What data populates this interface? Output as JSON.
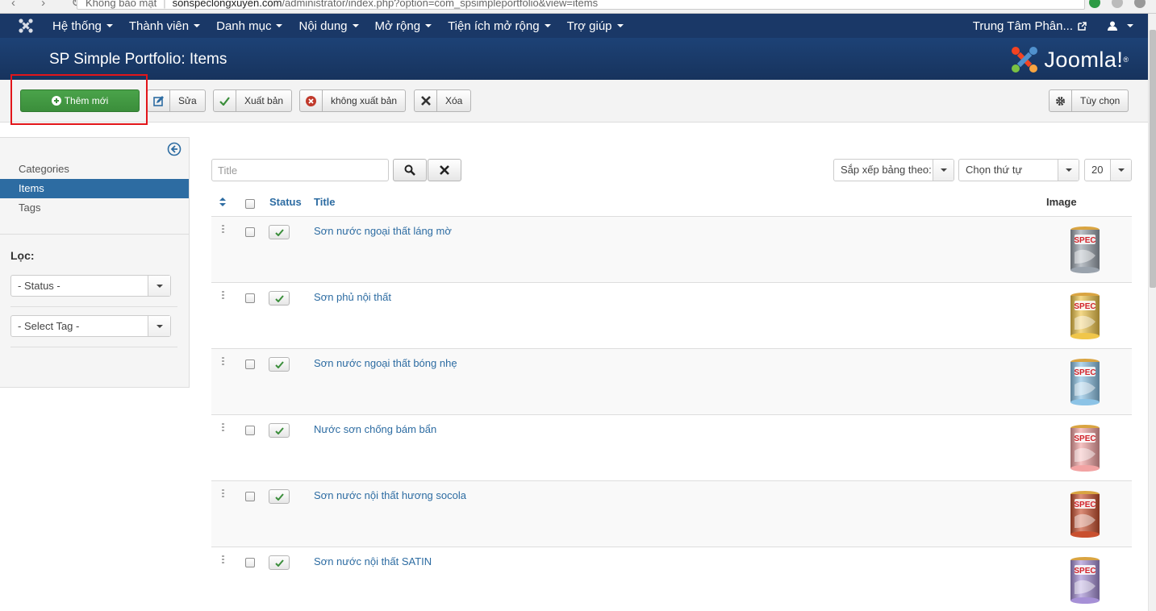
{
  "browser": {
    "security_label": "Không bảo mật",
    "host": "sonspeclongxuyen.com",
    "path": "/administrator/index.php?option=com_spsimpleportfolio&view=items"
  },
  "topmenu": {
    "items": [
      "Hệ thống",
      "Thành viên",
      "Danh mục",
      "Nội dung",
      "Mở rộng",
      "Tiện ích mở rộng",
      "Trợ giúp"
    ],
    "site_label": "Trung Tâm Phân..."
  },
  "header": {
    "title": "SP Simple Portfolio: Items",
    "brand": "Joomla!"
  },
  "toolbar": {
    "new_label": "Thêm mới",
    "edit_label": "Sửa",
    "publish_label": "Xuất bản",
    "unpublish_label": "không xuất bản",
    "delete_label": "Xóa",
    "options_label": "Tùy chọn"
  },
  "sidebar": {
    "items": [
      "Categories",
      "Items",
      "Tags"
    ],
    "active_item": "Items",
    "filter_label": "Lọc:",
    "status_select": "- Status -",
    "tag_select": "- Select Tag -"
  },
  "search": {
    "placeholder": "Title",
    "sort_by": "Sắp xếp bảng theo:",
    "order": "Chọn thứ tự",
    "limit": "20"
  },
  "table": {
    "headers": {
      "status": "Status",
      "title": "Title",
      "image": "Image"
    },
    "rows": [
      {
        "title": "Sơn nước ngoại thất láng mờ",
        "color": "#9aa3ad"
      },
      {
        "title": "Sơn phủ nội thất",
        "color": "#f0c64a"
      },
      {
        "title": "Sơn nước ngoại thất bóng nhẹ",
        "color": "#8cc3e6"
      },
      {
        "title": "Nước sơn chống bám bẩn",
        "color": "#f2a3a3"
      },
      {
        "title": "Sơn nước nội thất hương socola",
        "color": "#c9502f"
      },
      {
        "title": "Sơn nước nội thất SATIN",
        "color": "#a690d6"
      }
    ]
  },
  "colors": {
    "topbar": "#1a3867",
    "primary": "#2d6ca2",
    "success": "#3b8e3b",
    "highlight": "#e2151a"
  }
}
